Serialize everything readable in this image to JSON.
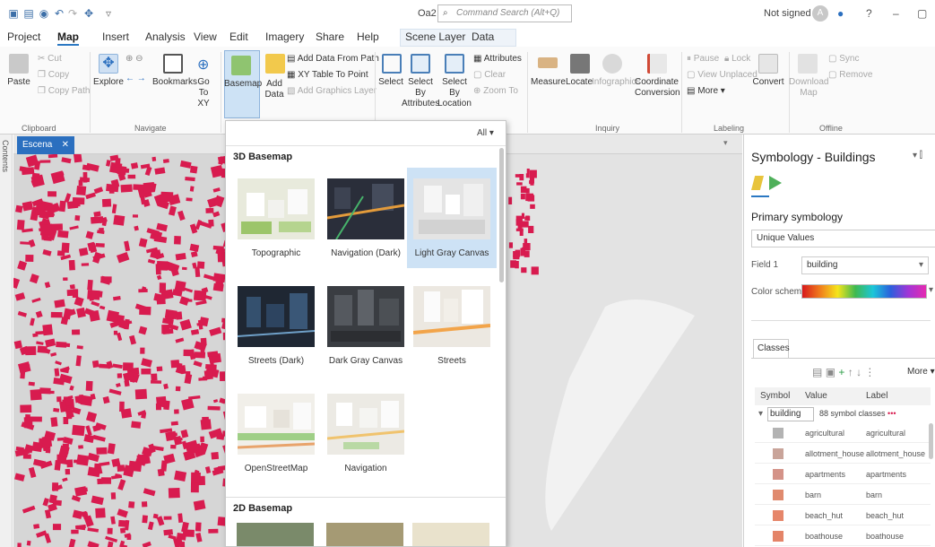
{
  "window": {
    "title": "Oa2",
    "command_search_placeholder": "Command Search (Alt+Q)",
    "sign_in": "Not signed in",
    "help": "?",
    "minimize": "–",
    "restore": "▢"
  },
  "tabs": [
    "Project",
    "Map",
    "Insert",
    "Analysis",
    "View",
    "Edit",
    "Imagery",
    "Share",
    "Help",
    "Scene Layer",
    "Data"
  ],
  "active_tab": "Map",
  "ribbon": {
    "clipboard": {
      "paste": "Paste",
      "cut": "Cut",
      "copy": "Copy",
      "copy_path": "Copy Path",
      "group": "Clipboard"
    },
    "navigate": {
      "explore": "Explore",
      "bookmarks": "Bookmarks",
      "go_to_xy": "Go To XY",
      "group": "Navigate"
    },
    "layer": {
      "basemap": "Basemap",
      "add_data": "Add Data",
      "add_data_from_path": "Add Data From Path",
      "xy_table_to_point": "XY Table To Point",
      "add_graphics_layer": "Add Graphics Layer"
    },
    "selection": {
      "select": "Select",
      "select_by_attributes": "Select By Attributes",
      "select_by_location": "Select By Location",
      "attributes": "Attributes",
      "clear": "Clear",
      "zoom_to": "Zoom To"
    },
    "inquiry": {
      "measure": "Measure",
      "locate": "Locate",
      "infographics": "Infographics",
      "coordinate_conversion": "Coordinate Conversion",
      "group": "Inquiry"
    },
    "labeling": {
      "pause": "Pause",
      "lock": "Lock",
      "view_unplaced": "View Unplaced",
      "more": "More",
      "convert": "Convert",
      "group": "Labeling"
    },
    "offline": {
      "download_map": "Download Map",
      "sync": "Sync",
      "remove": "Remove",
      "group": "Offline"
    }
  },
  "map": {
    "tab_label": "Escena",
    "contents_label": "Contents"
  },
  "basemap_gallery": {
    "filter": "All",
    "sections": [
      {
        "title": "3D Basemap",
        "items": [
          "Topographic",
          "Navigation (Dark)",
          "Light Gray Canvas",
          "Streets (Dark)",
          "Dark Gray Canvas",
          "Streets",
          "OpenStreetMap",
          "Navigation"
        ]
      },
      {
        "title": "2D Basemap",
        "items": []
      }
    ],
    "selected": "Light Gray Canvas"
  },
  "symbology": {
    "title": "Symbology - Buildings",
    "primary_label": "Primary symbology",
    "primary_value": "Unique Values",
    "field1_label": "Field 1",
    "field1_value": "building",
    "color_scheme_label": "Color scheme",
    "classes_tab": "Classes",
    "more": "More",
    "columns": [
      "Symbol",
      "Value",
      "Label"
    ],
    "group": {
      "name": "building",
      "summary": "88 symbol classes"
    },
    "rows": [
      {
        "value": "agricultural",
        "label": "agricultural",
        "color": "#b3b3b3"
      },
      {
        "value": "allotment_house",
        "label": "allotment_house",
        "color": "#c9a49a"
      },
      {
        "value": "apartments",
        "label": "apartments",
        "color": "#d49388"
      },
      {
        "value": "barn",
        "label": "barn",
        "color": "#e08a6e"
      },
      {
        "value": "beach_hut",
        "label": "beach_hut",
        "color": "#e6866a"
      },
      {
        "value": "boathouse",
        "label": "boathouse",
        "color": "#e48468"
      }
    ]
  },
  "colors": {
    "accent": "#2b78c2",
    "buildings": "#d81b4f",
    "map_bg": "#d6d6d6",
    "selected_tile": "#cde2f5"
  }
}
